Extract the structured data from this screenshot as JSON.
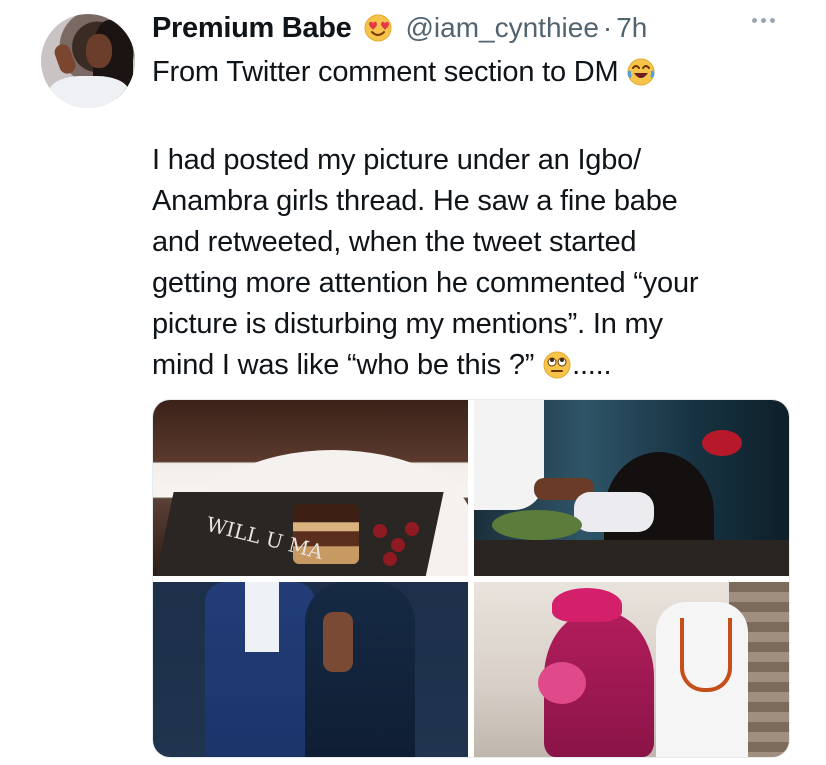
{
  "tweet": {
    "display_name": "Premium Babe",
    "name_emoji": "😍",
    "handle": "@iam_cynthiee",
    "separator": "·",
    "time": "7h",
    "text_line1": "From Twitter comment section to DM",
    "text_line1_emoji": "😂",
    "paragraph_lines": [
      "I had posted my picture under an Igbo/",
      "Anambra girls thread. He saw a fine babe",
      "and retweeted, when the tweet started",
      "getting more attention he commented “your",
      "picture is disturbing my mentions”. In my",
      "mind I was like “who be this ?”"
    ],
    "last_line_emoji": "🙄",
    "last_line_tail": "....."
  },
  "media": {
    "images": [
      {
        "label": "WILL U MA"
      }
    ]
  },
  "icons": {
    "more": "more-icon"
  }
}
